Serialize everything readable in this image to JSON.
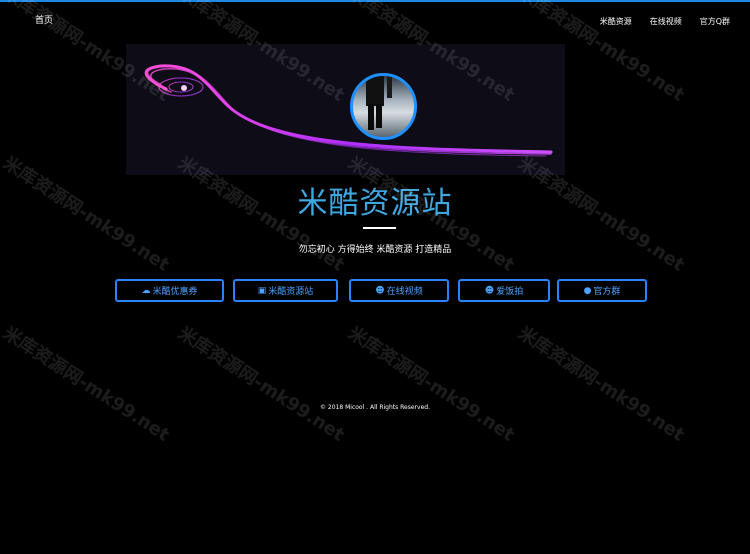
{
  "nav": {
    "home": "首页",
    "links": [
      "米酷资源",
      "在线视频",
      "官方Q群"
    ]
  },
  "hero": {
    "title": "米酷资源站",
    "slogan": "勿忘初心 方得始终 米酷资源 打造精品"
  },
  "buttons": [
    {
      "icon": "cloud-icon",
      "label": "米酷优惠券"
    },
    {
      "icon": "v-badge-icon",
      "label": "米酷资源站"
    },
    {
      "icon": "users-icon",
      "label": "在线视频"
    },
    {
      "icon": "group-icon",
      "label": "爱饭拍"
    },
    {
      "icon": "qq-icon",
      "label": "官方群"
    }
  ],
  "footer": "© 2018 Micool . All Rights Reserved.",
  "watermark": "米库资源网-mk99.net",
  "colors": {
    "accent": "#1e88e5",
    "title": "#3fa7e0",
    "button_border": "#2b82ff"
  }
}
